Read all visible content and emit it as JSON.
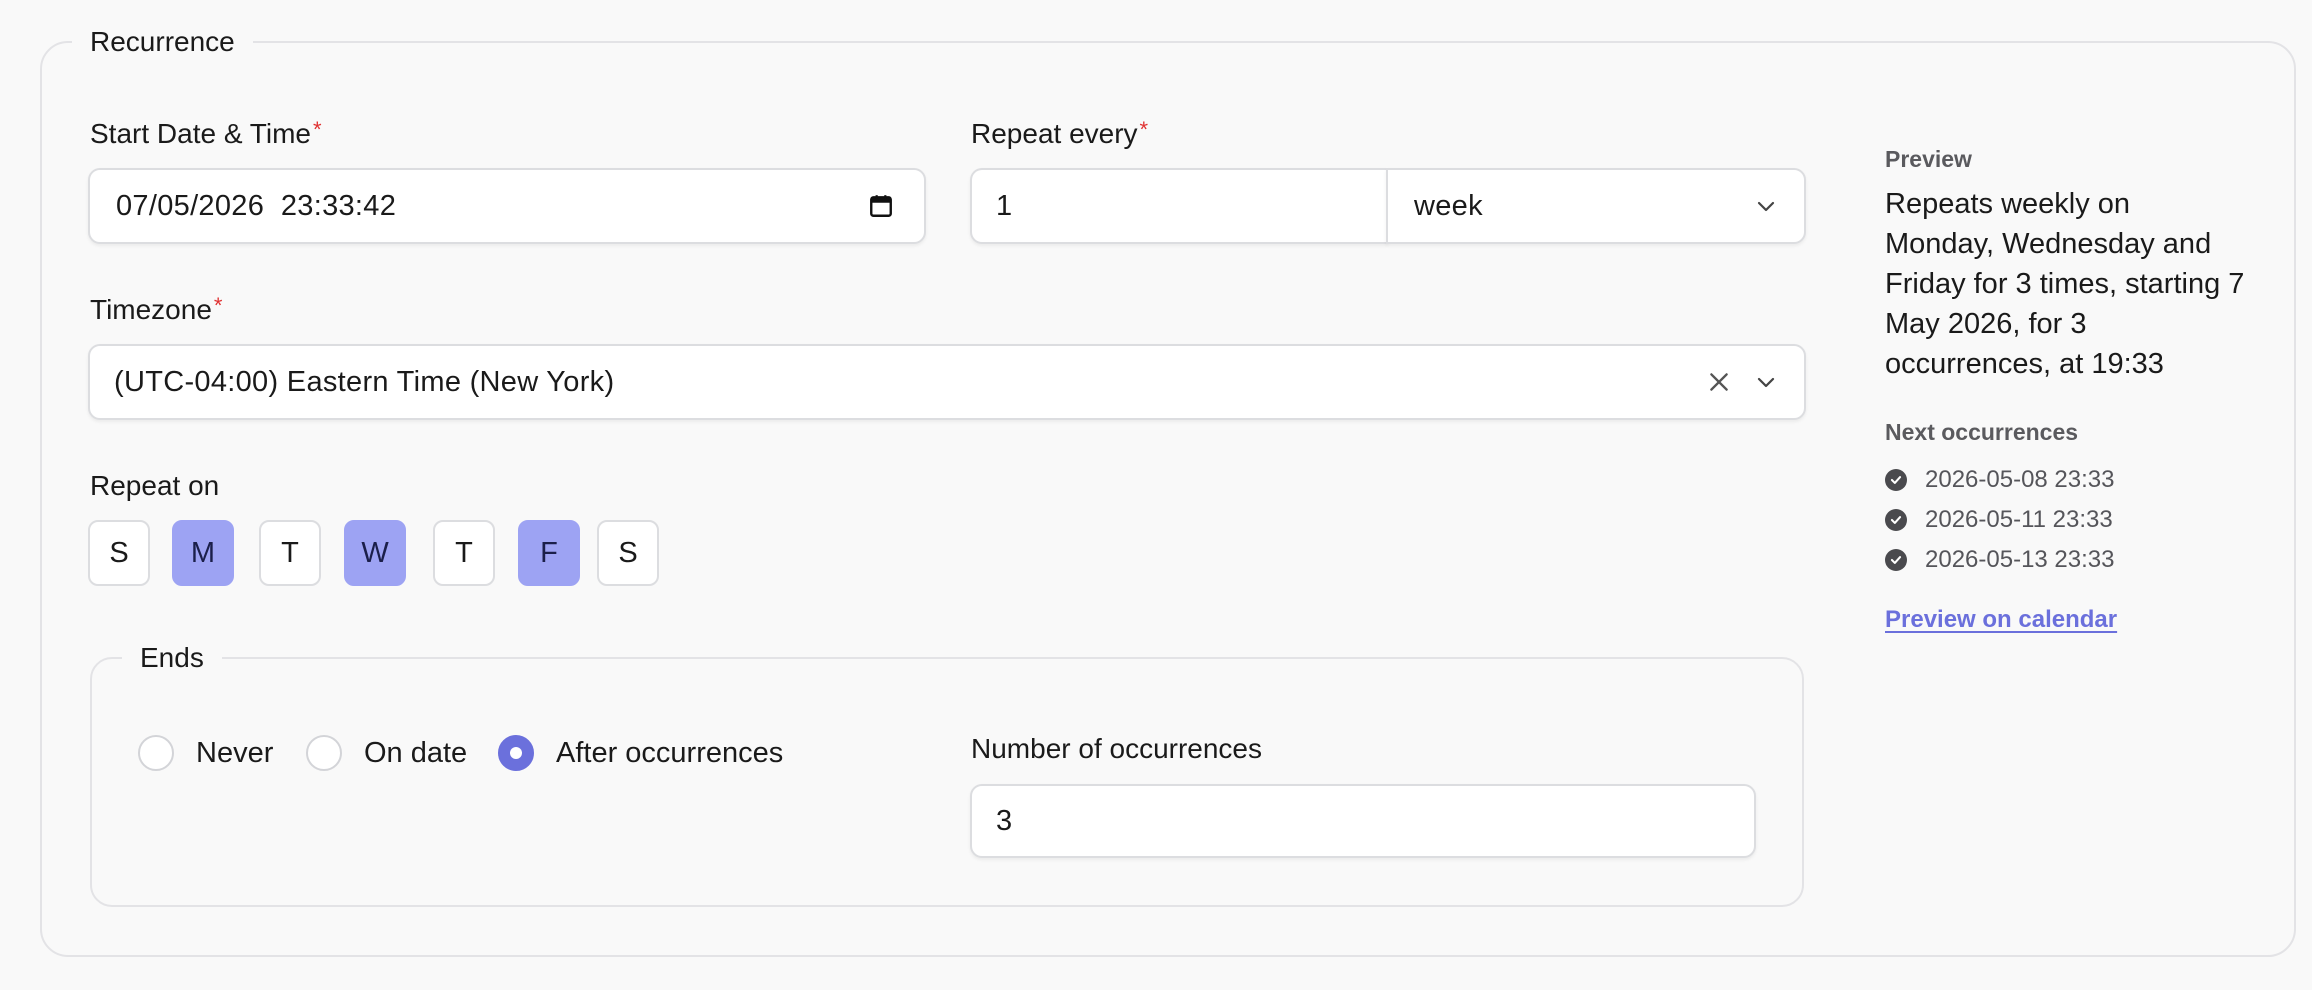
{
  "recurrence": {
    "legend": "Recurrence",
    "start": {
      "label": "Start Date & Time",
      "required": "*",
      "value": "07/05/2026  23:33:42"
    },
    "repeat_every": {
      "label": "Repeat every",
      "required": "*",
      "interval": "1",
      "unit": "week"
    },
    "timezone": {
      "label": "Timezone",
      "required": "*",
      "value": "(UTC-04:00) Eastern Time (New York)"
    },
    "repeat_on": {
      "label": "Repeat on",
      "days": [
        {
          "label": "S",
          "selected": false
        },
        {
          "label": "M",
          "selected": true
        },
        {
          "label": "T",
          "selected": false
        },
        {
          "label": "W",
          "selected": true
        },
        {
          "label": "T",
          "selected": false
        },
        {
          "label": "F",
          "selected": true
        },
        {
          "label": "S",
          "selected": false
        }
      ]
    },
    "ends": {
      "legend": "Ends",
      "options": [
        {
          "label": "Never",
          "checked": false
        },
        {
          "label": "On date",
          "checked": false
        },
        {
          "label": "After occurrences",
          "checked": true
        }
      ],
      "occurrences_label": "Number of occurrences",
      "occurrences_value": "3"
    }
  },
  "preview": {
    "heading": "Preview",
    "summary": "Repeats weekly on Monday, Wednesday and Friday for 3 times, starting 7 May 2026, for 3 occurrences, at 19:33",
    "next_heading": "Next occurrences",
    "next": [
      "2026-05-08 23:33",
      "2026-05-11 23:33",
      "2026-05-13 23:33"
    ],
    "calendar_link": "Preview on calendar"
  },
  "colors": {
    "accent": "#6b70dc",
    "day_selected": "#9da3f3",
    "required": "#e03131"
  }
}
